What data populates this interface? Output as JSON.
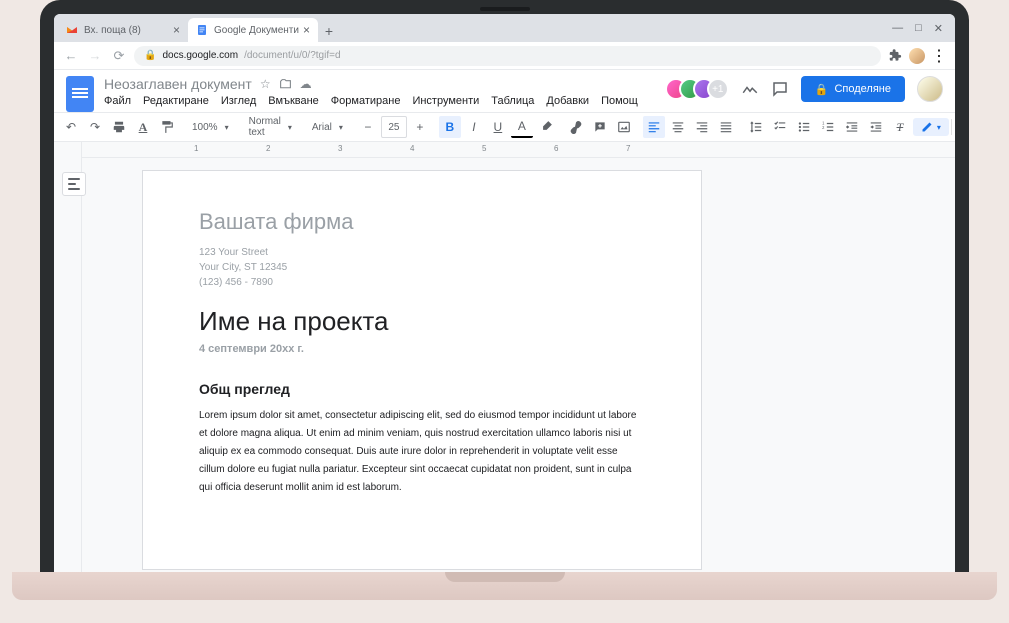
{
  "browser": {
    "tabs": [
      {
        "title": "Вх. поща (8)",
        "active": false
      },
      {
        "title": "Google Документи",
        "active": true
      }
    ],
    "url_domain": "docs.google.com",
    "url_path": "/document/u/0/?tgif=d"
  },
  "docs": {
    "title": "Неозаглавен документ",
    "menu": [
      "Файл",
      "Редактиране",
      "Изглед",
      "Вмъкване",
      "Форматиране",
      "Инструменти",
      "Таблица",
      "Добавки",
      "Помощ"
    ],
    "share_label": "Споделяне",
    "collaborator_count": "+1"
  },
  "toolbar": {
    "zoom": "100%",
    "style": "Normal text",
    "font": "Arial",
    "size": "25"
  },
  "ruler": [
    "1",
    "2",
    "3",
    "4",
    "5",
    "6",
    "7"
  ],
  "document": {
    "company": "Вашата фирма",
    "address_line1": "123 Your Street",
    "address_line2": "Your City, ST 12345",
    "phone": "(123) 456 - 7890",
    "title": "Име на проекта",
    "date": "4 септември 20xx г.",
    "section_heading": "Общ преглед",
    "body": "Lorem ipsum dolor sit amet, consectetur adipiscing elit, sed do eiusmod tempor incididunt ut labore et dolore magna aliqua. Ut enim ad minim veniam, quis nostrud exercitation ullamco laboris nisi ut aliquip ex ea commodo consequat. Duis aute irure dolor in reprehenderit in voluptate velit esse cillum dolore eu fugiat nulla pariatur. Excepteur sint occaecat cupidatat non proident, sunt in culpa qui officia deserunt mollit anim id est laborum."
  }
}
